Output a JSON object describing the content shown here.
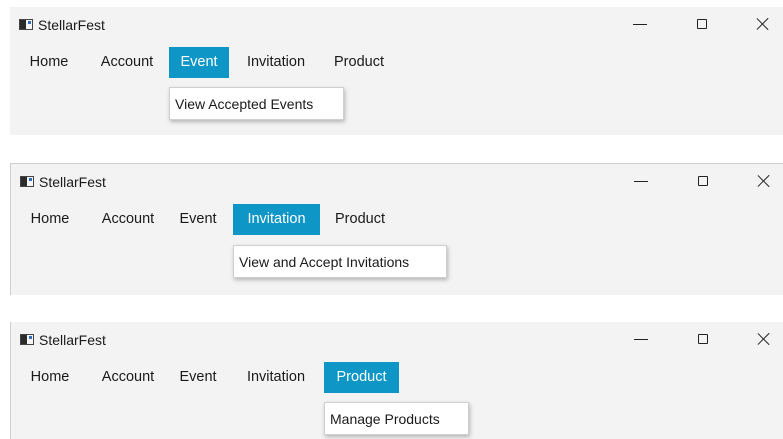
{
  "app_title": "StellarFest",
  "window_controls": {
    "minimize": "minimize-icon",
    "maximize": "maximize-icon",
    "close": "close-icon"
  },
  "menu": {
    "home": "Home",
    "account": "Account",
    "event": "Event",
    "invitation": "Invitation",
    "product": "Product"
  },
  "accent_color": "#0d96c6",
  "screens": [
    {
      "active_menu": "Event",
      "dropdown_item": "View Accepted Events"
    },
    {
      "active_menu": "Invitation",
      "dropdown_item": "View and Accept Invitations"
    },
    {
      "active_menu": "Product",
      "dropdown_item": "Manage Products"
    }
  ]
}
